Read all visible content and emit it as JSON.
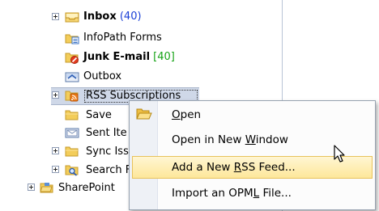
{
  "folders": {
    "inbox": {
      "label": "Inbox",
      "count": "(40)"
    },
    "infopath": {
      "label": "InfoPath Forms"
    },
    "junk": {
      "label": "Junk E-mail",
      "count": "[40]"
    },
    "outbox": {
      "label": "Outbox"
    },
    "rss": {
      "label": "RSS Subscriptions"
    },
    "save": {
      "label": "Save"
    },
    "sent": {
      "label": "Sent Ite"
    },
    "sync": {
      "label": "Sync Iss"
    },
    "search": {
      "label": "Search F"
    },
    "sharepoint": {
      "label": "SharePoint"
    }
  },
  "context_menu": {
    "items": [
      {
        "pre": "",
        "key": "O",
        "post": "pen"
      },
      {
        "pre": "Open in New ",
        "key": "W",
        "post": "indow"
      },
      {
        "pre": "Add a New ",
        "key": "R",
        "post": "SS Feed..."
      },
      {
        "pre": "Import an OPM",
        "key": "L",
        "post": " File..."
      }
    ]
  },
  "colors": {
    "count_blue": "#1a3fd6",
    "count_green": "#16a316",
    "selection": "#cfd8e8",
    "menu_highlight": "#fde79a"
  }
}
